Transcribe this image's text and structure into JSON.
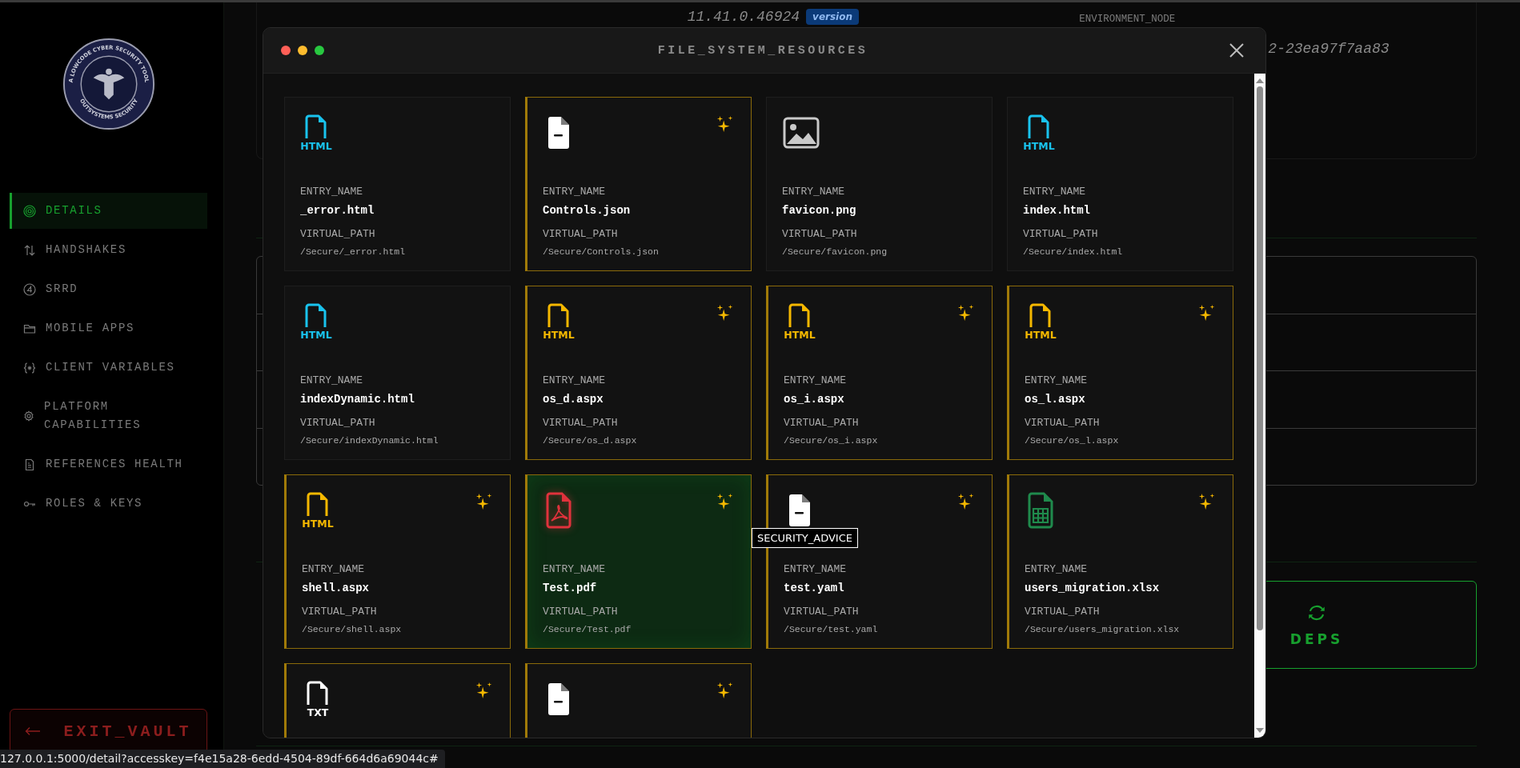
{
  "sidebar": {
    "logo": {
      "top_text": "A LOWCODE CYBER SECURITY TOOL",
      "bottom_text": "OUTSYSTEMS SECURITY"
    },
    "items": [
      {
        "label": "DETAILS",
        "selected": true
      },
      {
        "label": "HANDSHAKES",
        "selected": false
      },
      {
        "label": "SRRD",
        "selected": false
      },
      {
        "label": "MOBILE APPS",
        "selected": false
      },
      {
        "label": "CLIENT VARIABLES",
        "selected": false
      },
      {
        "label": "PLATFORM CAPABILITIES",
        "selected": false
      },
      {
        "label": "REFERENCES HEALTH",
        "selected": false
      },
      {
        "label": "ROLES & KEYS",
        "selected": false
      }
    ],
    "exit_button": "EXIT_VAULT"
  },
  "background": {
    "version": "11.41.0.46924",
    "version_badge": "version",
    "environment_label": "ENVIRONMENT_NODE",
    "environment_value": "2-23ea97f7aa83",
    "deps_button": "DEPS"
  },
  "modal": {
    "title": "FILE_SYSTEM_RESOURCES",
    "cards": [
      {
        "kind": "html",
        "icon_label": "HTML",
        "color": "#19c3ee",
        "flagged": false,
        "selected": false,
        "name_label": "ENTRY_NAME",
        "name": "_error.html",
        "path_label": "VIRTUAL_PATH",
        "path": "/Secure/_error.html"
      },
      {
        "kind": "doc",
        "color": "#ffffff",
        "flagged": true,
        "selected": false,
        "name_label": "ENTRY_NAME",
        "name": "Controls.json",
        "path_label": "VIRTUAL_PATH",
        "path": "/Secure/Controls.json"
      },
      {
        "kind": "image",
        "color": "#c9c9c9",
        "flagged": false,
        "selected": false,
        "name_label": "ENTRY_NAME",
        "name": "favicon.png",
        "path_label": "VIRTUAL_PATH",
        "path": "/Secure/favicon.png"
      },
      {
        "kind": "html",
        "icon_label": "HTML",
        "color": "#19c3ee",
        "flagged": false,
        "selected": false,
        "name_label": "ENTRY_NAME",
        "name": "index.html",
        "path_label": "VIRTUAL_PATH",
        "path": "/Secure/index.html"
      },
      {
        "kind": "html",
        "icon_label": "HTML",
        "color": "#19c3ee",
        "flagged": false,
        "selected": false,
        "name_label": "ENTRY_NAME",
        "name": "indexDynamic.html",
        "path_label": "VIRTUAL_PATH",
        "path": "/Secure/indexDynamic.html"
      },
      {
        "kind": "html",
        "icon_label": "HTML",
        "color": "#f5b800",
        "flagged": true,
        "selected": false,
        "name_label": "ENTRY_NAME",
        "name": "os_d.aspx",
        "path_label": "VIRTUAL_PATH",
        "path": "/Secure/os_d.aspx"
      },
      {
        "kind": "html",
        "icon_label": "HTML",
        "color": "#f5b800",
        "flagged": true,
        "selected": false,
        "name_label": "ENTRY_NAME",
        "name": "os_i.aspx",
        "path_label": "VIRTUAL_PATH",
        "path": "/Secure/os_i.aspx"
      },
      {
        "kind": "html",
        "icon_label": "HTML",
        "color": "#f5b800",
        "flagged": true,
        "selected": false,
        "name_label": "ENTRY_NAME",
        "name": "os_l.aspx",
        "path_label": "VIRTUAL_PATH",
        "path": "/Secure/os_l.aspx"
      },
      {
        "kind": "html",
        "icon_label": "HTML",
        "color": "#f5b800",
        "flagged": true,
        "selected": false,
        "name_label": "ENTRY_NAME",
        "name": "shell.aspx",
        "path_label": "VIRTUAL_PATH",
        "path": "/Secure/shell.aspx"
      },
      {
        "kind": "pdf",
        "color": "#e0323c",
        "flagged": true,
        "selected": true,
        "name_label": "ENTRY_NAME",
        "name": "Test.pdf",
        "path_label": "VIRTUAL_PATH",
        "path": "/Secure/Test.pdf"
      },
      {
        "kind": "doc",
        "color": "#ffffff",
        "flagged": true,
        "selected": false,
        "tooltip": "SECURITY_ADVICE",
        "name_label": "ENTRY_NAME",
        "name": "test.yaml",
        "path_label": "VIRTUAL_PATH",
        "path": "/Secure/test.yaml"
      },
      {
        "kind": "sheet",
        "color": "#1f8a4c",
        "flagged": true,
        "selected": false,
        "name_label": "ENTRY_NAME",
        "name": "users_migration.xlsx",
        "path_label": "VIRTUAL_PATH",
        "path": "/Secure/users_migration.xlsx"
      },
      {
        "kind": "txt",
        "icon_label": "TXT",
        "color": "#ffffff",
        "flagged": true,
        "selected": false
      },
      {
        "kind": "doc",
        "color": "#ffffff",
        "flagged": true,
        "selected": false
      }
    ]
  },
  "status_bar": {
    "url": "127.0.0.1:5000/detail?accesskey=f4e15a28-6edd-4504-89df-664d6a69044c#"
  }
}
